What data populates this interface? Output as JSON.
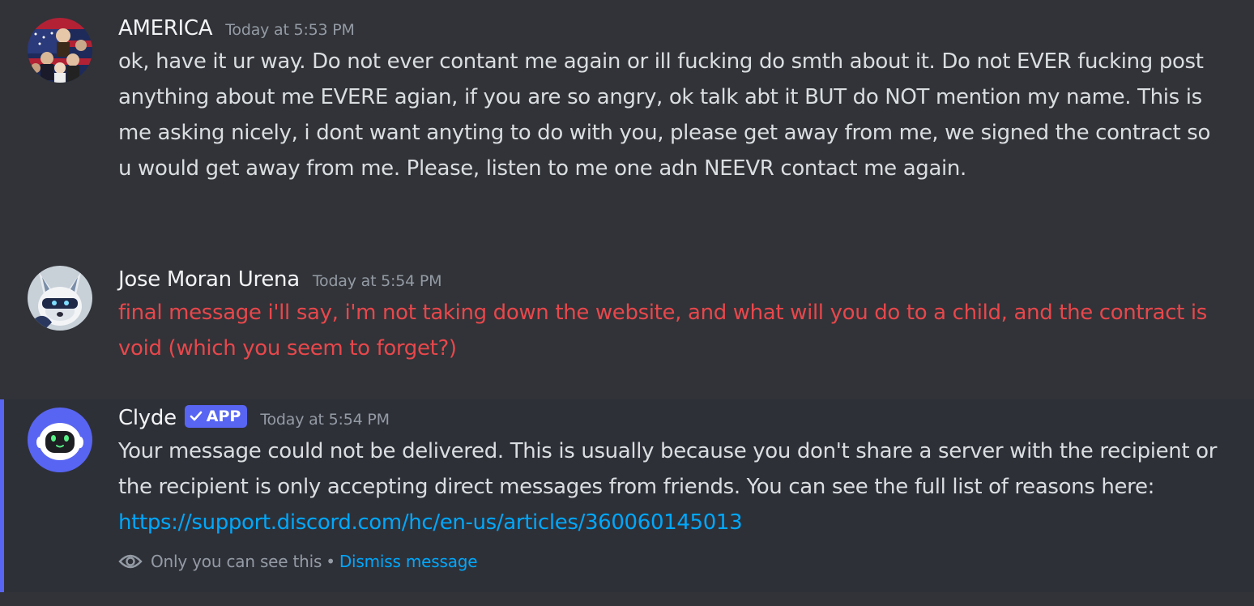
{
  "messages": [
    {
      "username": "AMERICA",
      "timestamp": "Today at 5:53 PM",
      "text": "ok, have it ur way. Do not ever contant me again or ill fucking do smth about it. Do not EVER fucking post anything about me EVERE agian, if you are so angry, ok talk abt it BUT do NOT mention my name. This is me asking nicely, i dont want anyting to do with you, please get away from me, we signed the contract so u would get away from me. Please, listen to me one adn NEEVR contact me again."
    },
    {
      "username": "Jose Moran Urena",
      "timestamp": "Today at 5:54 PM",
      "text": "final message i'll say, i'm not taking down the website, and what will you do to a child, and the contract is void (which you seem to forget?)",
      "text_color": "#e8474b"
    },
    {
      "username": "Clyde",
      "badge": "APP",
      "timestamp": "Today at 5:54 PM",
      "text": "Your message could not be delivered. This is usually because you don't share a server with the recipient or the recipient is only accepting direct messages from friends. You can see the full list of reasons here: ",
      "link": "https://support.discord.com/hc/en-us/articles/360060145013",
      "ephemeral_note": "Only you can see this",
      "separator": "•",
      "dismiss_label": "Dismiss message"
    }
  ],
  "colors": {
    "background": "#313338",
    "ephemeral_background": "#2e3038",
    "accent": "#5865f2",
    "link": "#00a8fc",
    "muted": "#949ba4"
  }
}
